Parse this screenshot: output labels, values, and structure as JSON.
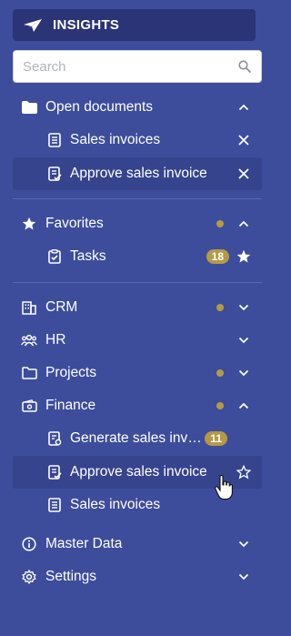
{
  "brand": {
    "title": "INSIGHTS"
  },
  "search": {
    "placeholder": "Search"
  },
  "colors": {
    "sidebar_bg": "#3d4d9c",
    "brand_bg": "#2a3476",
    "accent_gold": "#b59a45",
    "row_highlight": "#36448e"
  },
  "open_documents": {
    "label": "Open documents",
    "items": [
      {
        "label": "Sales invoices",
        "icon": "document-list-icon"
      },
      {
        "label": "Approve sales invoice",
        "icon": "document-check-icon"
      }
    ]
  },
  "favorites": {
    "label": "Favorites",
    "items": [
      {
        "label": "Tasks",
        "badge": "18",
        "icon": "clipboard-check-icon"
      }
    ]
  },
  "nav": {
    "crm": "CRM",
    "hr": "HR",
    "projects": "Projects",
    "finance": {
      "label": "Finance",
      "items": [
        {
          "label": "Generate sales invoices",
          "badge": "11",
          "icon": "document-gear-icon"
        },
        {
          "label": "Approve sales invoice",
          "icon": "document-check-icon"
        },
        {
          "label": "Sales invoices",
          "icon": "document-list-icon"
        }
      ]
    },
    "master_data": "Master Data",
    "settings": "Settings"
  }
}
